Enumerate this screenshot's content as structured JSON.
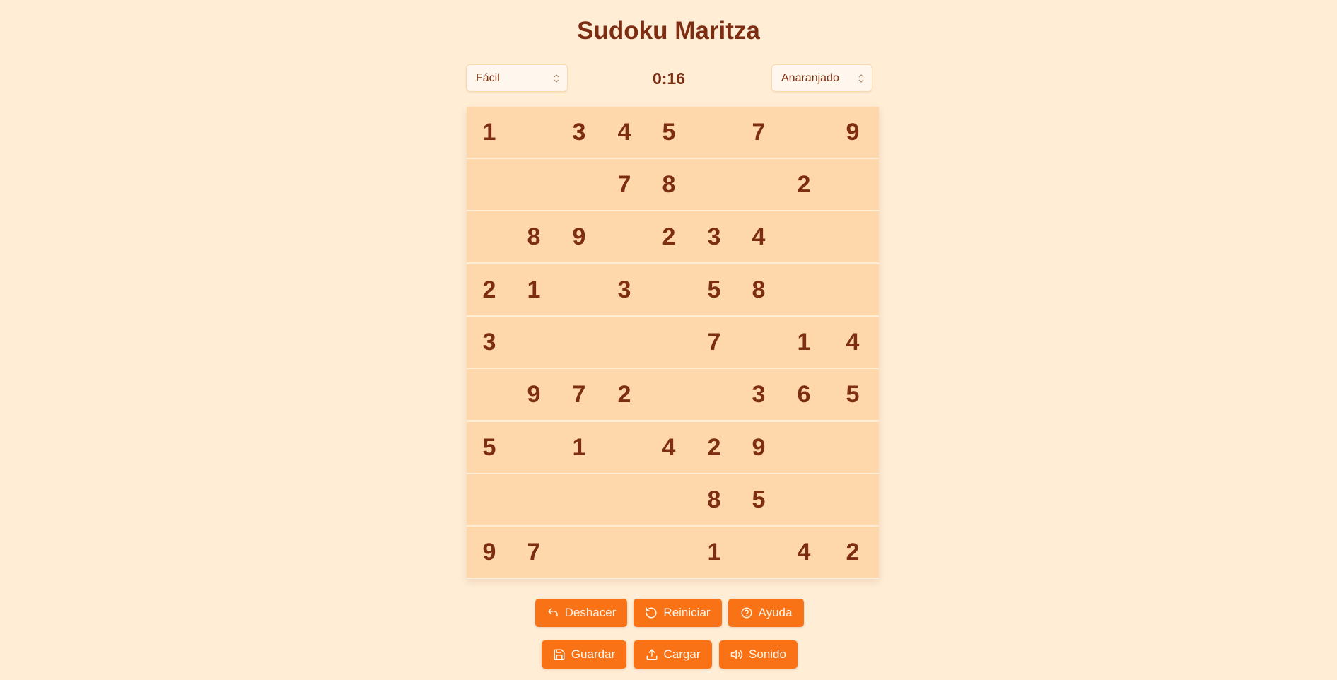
{
  "app": {
    "title": "Sudoku Maritza"
  },
  "controls": {
    "difficulty": "Fácil",
    "timer": "0:16",
    "theme": "Anaranjado"
  },
  "board": {
    "rows": [
      [
        "1",
        "",
        "3",
        "4",
        "5",
        "",
        "7",
        "",
        "9"
      ],
      [
        "",
        "",
        "",
        "7",
        "8",
        "",
        "",
        "2",
        ""
      ],
      [
        "",
        "8",
        "9",
        "",
        "2",
        "3",
        "4",
        "",
        ""
      ],
      [
        "2",
        "1",
        "",
        "3",
        "",
        "5",
        "8",
        "",
        ""
      ],
      [
        "3",
        "",
        "",
        "",
        "",
        "7",
        "",
        "1",
        "4"
      ],
      [
        "",
        "9",
        "7",
        "2",
        "",
        "",
        "3",
        "6",
        "5"
      ],
      [
        "5",
        "",
        "1",
        "",
        "4",
        "2",
        "9",
        "",
        ""
      ],
      [
        "",
        "",
        "",
        "",
        "",
        "8",
        "5",
        "",
        ""
      ],
      [
        "9",
        "7",
        "",
        "",
        "",
        "1",
        "",
        "4",
        "2"
      ]
    ]
  },
  "buttons": {
    "undo": "Deshacer",
    "reset": "Reiniciar",
    "help": "Ayuda",
    "save": "Guardar",
    "load": "Cargar",
    "sound": "Sonido"
  },
  "icons": {
    "undo": "undo-icon",
    "reset": "rotate-ccw-icon",
    "help": "help-circle-icon",
    "save": "save-icon",
    "load": "upload-icon",
    "sound": "volume-icon",
    "select_chevron": "chevron-up-down-icon"
  },
  "colors": {
    "background": "#ffedd5",
    "cell": "#fed7aa",
    "text": "#7c2d12",
    "accent": "#f97316"
  }
}
